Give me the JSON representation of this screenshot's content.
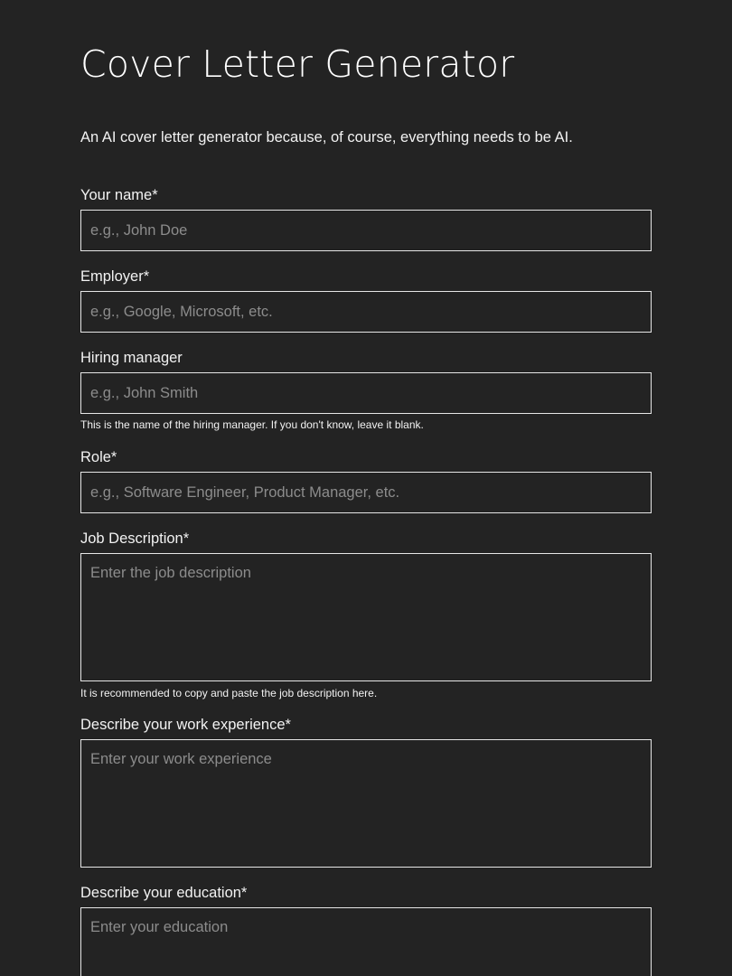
{
  "header": {
    "title": "Cover Letter Generator",
    "subtitle": "An AI cover letter generator because, of course, everything needs to be AI."
  },
  "form": {
    "name": {
      "label": "Your name*",
      "placeholder": "e.g., John Doe",
      "value": ""
    },
    "employer": {
      "label": "Employer*",
      "placeholder": "e.g., Google, Microsoft, etc.",
      "value": ""
    },
    "hiring_manager": {
      "label": "Hiring manager",
      "placeholder": "e.g., John Smith",
      "value": "",
      "hint": "This is the name of the hiring manager. If you don't know, leave it blank."
    },
    "role": {
      "label": "Role*",
      "placeholder": "e.g., Software Engineer, Product Manager, etc.",
      "value": ""
    },
    "job_description": {
      "label": "Job Description*",
      "placeholder": "Enter the job description",
      "value": "",
      "hint": "It is recommended to copy and paste the job description here."
    },
    "work_experience": {
      "label": "Describe your work experience*",
      "placeholder": "Enter your work experience",
      "value": ""
    },
    "education": {
      "label": "Describe your education*",
      "placeholder": "Enter your education",
      "value": ""
    }
  },
  "colors": {
    "background": "#232323",
    "text": "#f2f2f2",
    "border": "#e6e6e6",
    "placeholder": "#8c8c8c"
  }
}
